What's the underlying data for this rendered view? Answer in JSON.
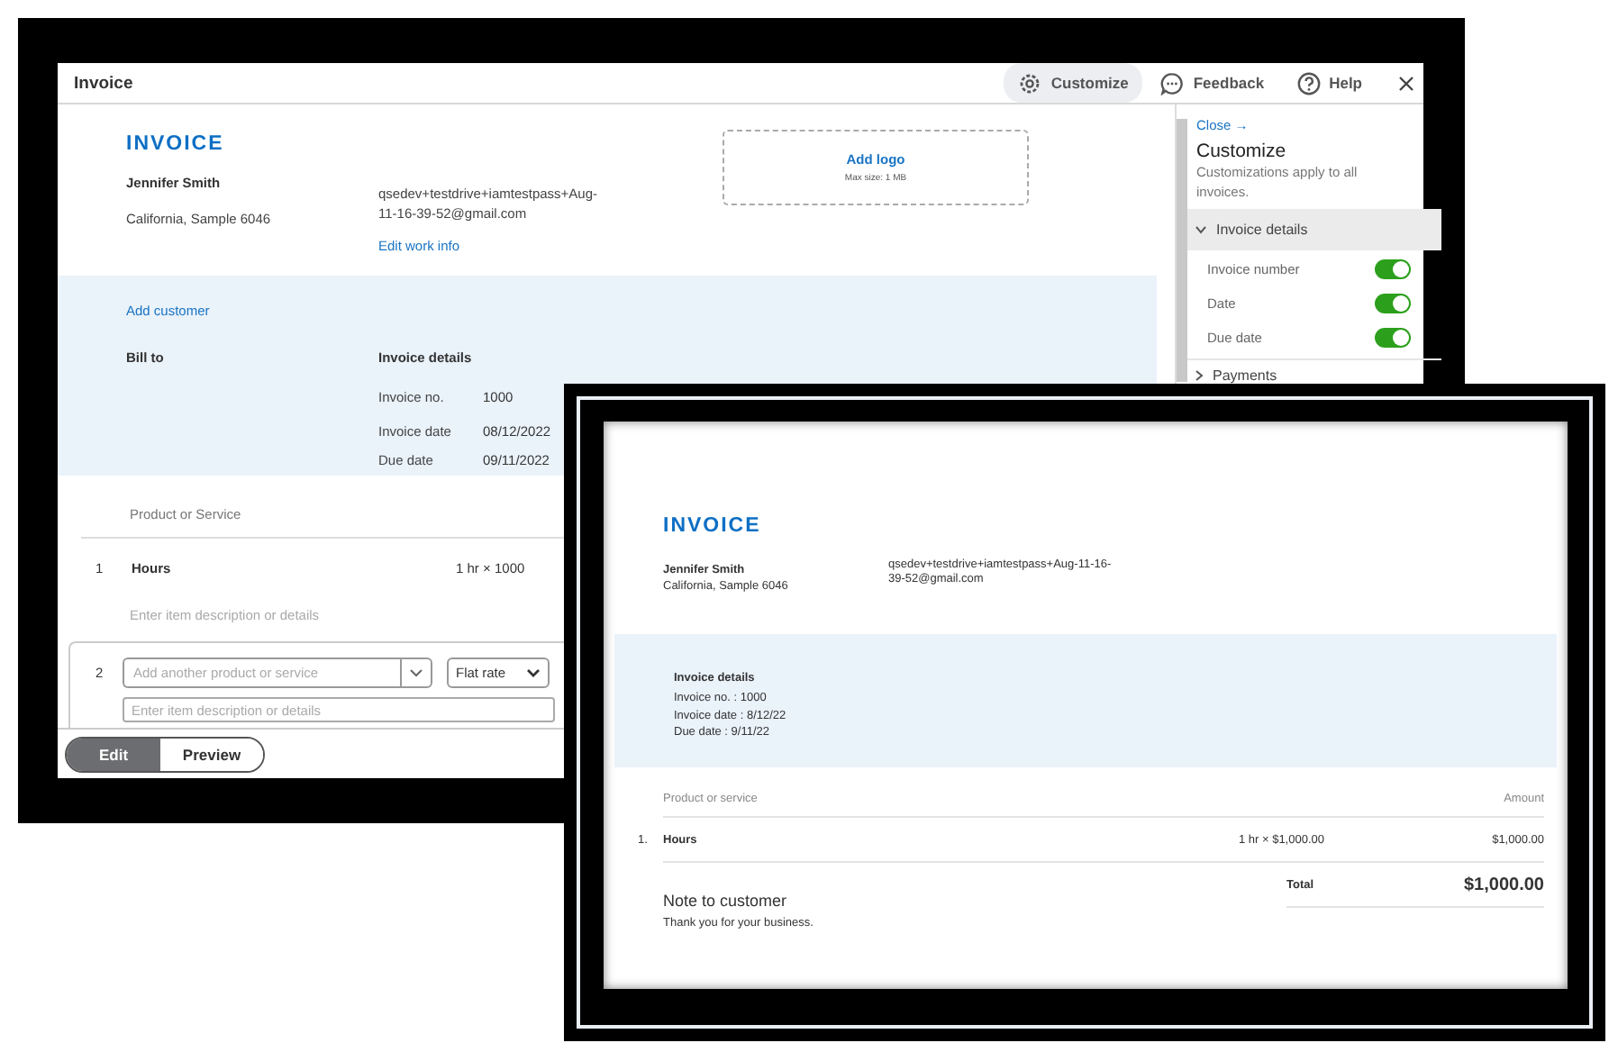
{
  "editor_window": {
    "title": "Invoice",
    "toolbar": [
      {
        "kind": "customize",
        "label": "Customize",
        "selected": true
      },
      {
        "kind": "feedback",
        "label": "Feedback",
        "selected": false
      },
      {
        "kind": "help",
        "label": "Help",
        "selected": false
      }
    ],
    "invoice": {
      "heading": "INVOICE",
      "company_name": "Jennifer Smith",
      "company_address": "California, Sample 6046",
      "email": "qsedev+testdrive+iamtestpass+Aug-11-16-39-52@gmail.com",
      "edit_link": "Edit work info",
      "logo": {
        "label": "Add logo",
        "hint": "Max size: 1 MB"
      }
    },
    "customer": {
      "add_link": "Add customer",
      "bill_to": "Bill to",
      "details_title": "Invoice details",
      "details": [
        {
          "label": "Invoice no.",
          "value": "1000"
        },
        {
          "label": "Invoice date",
          "value": "08/12/2022"
        },
        {
          "label": "Due date",
          "value": "09/11/2022"
        }
      ]
    },
    "lines": {
      "column": "Product or Service",
      "items": [
        {
          "number": "1",
          "name": "Hours",
          "quantity": "1 hr × 1000",
          "description_placeholder": "Enter item description or details"
        }
      ],
      "new_line": {
        "number": "2",
        "product_placeholder": "Add another product or service",
        "rate_type": "Flat rate",
        "description_placeholder": "Enter item description or details"
      }
    },
    "mode_toggle": [
      {
        "label": "Edit",
        "selected": true
      },
      {
        "label": "Preview",
        "selected": false
      }
    ],
    "customize_panel": {
      "close_link": "Close →",
      "title": "Customize",
      "subtitle": "Customizations apply to all invoices.",
      "sections": [
        {
          "label": "Invoice details",
          "expanded": true,
          "options": [
            {
              "label": "Invoice number",
              "on": true
            },
            {
              "label": "Date",
              "on": true
            },
            {
              "label": "Due date",
              "on": true
            }
          ]
        },
        {
          "label": "Payments",
          "expanded": false
        }
      ]
    }
  },
  "preview_window": {
    "heading": "INVOICE",
    "company_name": "Jennifer Smith",
    "company_address": "California, Sample 6046",
    "email": "qsedev+testdrive+iamtestpass+Aug-11-16-39-52@gmail.com",
    "details_title": "Invoice details",
    "details": [
      "Invoice no. : 1000",
      "Invoice date : 8/12/22",
      "Due date : 9/11/22"
    ],
    "columns": [
      "Product or service",
      "Amount"
    ],
    "items": [
      {
        "number": "1.",
        "name": "Hours",
        "quantity": "1 hr × $1,000.00",
        "amount": "$1,000.00"
      }
    ],
    "total_label": "Total",
    "total": "$1,000.00",
    "note_title": "Note to customer",
    "note": "Thank you for your business."
  }
}
